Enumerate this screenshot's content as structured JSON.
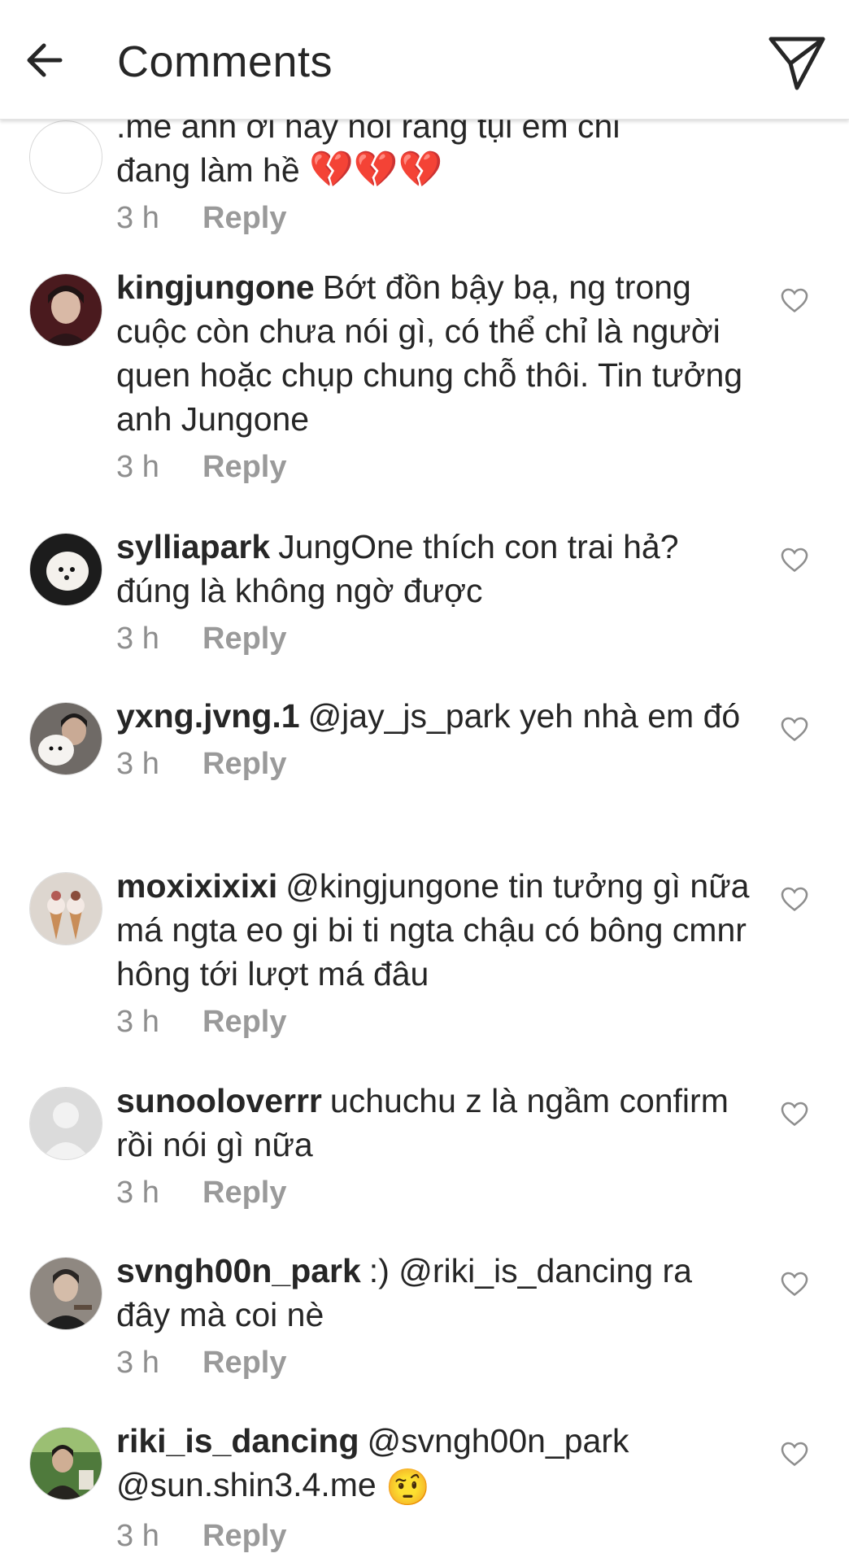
{
  "header": {
    "title": "Comments",
    "back_icon": "back-arrow-icon",
    "send_icon": "paper-plane-icon"
  },
  "colors": {
    "text": "#262626",
    "meta": "#8e8e8e",
    "broken_heart": "#ec2c7f"
  },
  "partial_comment": {
    "cut_line": ".me anh ơi hãy nói rằng tụi em chỉ",
    "line2": "đang làm hề",
    "emoji": "💔💔💔",
    "time": "3 h",
    "reply": "Reply"
  },
  "comments": [
    {
      "username": "kingjungone",
      "text": "Bớt đồn bậy bạ, ng trong cuộc còn chưa nói gì, có thể chỉ là người quen hoặc chụp chung chỗ thôi. Tin tưởng anh Jungone",
      "time": "3 h",
      "reply": "Reply"
    },
    {
      "username": "sylliapark",
      "text": "JungOne thích con trai hả? đúng là không ngờ được",
      "time": "3 h",
      "reply": "Reply"
    },
    {
      "username": "yxng.jvng.1",
      "text": "@jay_js_park yeh nhà em đó",
      "time": "3 h",
      "reply": "Reply"
    },
    {
      "username": "moxixixixi",
      "text": "@kingjungone tin tưởng gì nữa má ngta eo gi bi ti ngta chậu có bông cmnr hông tới lượt má đâu",
      "time": "3 h",
      "reply": "Reply"
    },
    {
      "username": "sunooloverrr",
      "text": "uchuchu z là ngầm confirm rồi nói gì nữa",
      "time": "3 h",
      "reply": "Reply"
    },
    {
      "username": "svngh00n_park",
      "text": ":) @riki_is_dancing ra đây mà coi nè",
      "time": "3 h",
      "reply": "Reply"
    },
    {
      "username": "riki_is_dancing",
      "text": "@svngh00n_park @sun.shin3.4.me",
      "emoji": "🤨",
      "time": "3 h",
      "reply": "Reply"
    }
  ]
}
